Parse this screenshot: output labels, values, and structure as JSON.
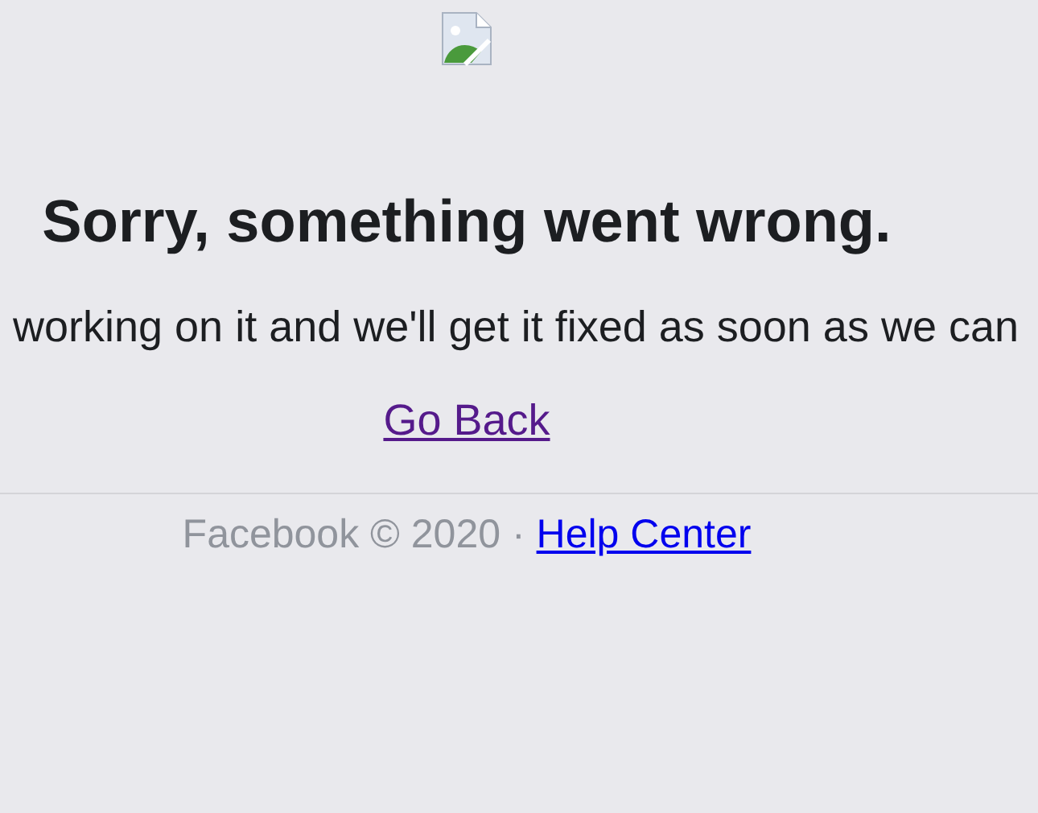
{
  "heading": "Sorry, something went wrong.",
  "message": "working on it and we'll get it fixed as soon as we can",
  "back_link": {
    "label": "Go Back",
    "visited": true
  },
  "footer": {
    "copyright": "Facebook © 2020 ·",
    "link": {
      "label": "Help Center",
      "visited": false
    }
  }
}
